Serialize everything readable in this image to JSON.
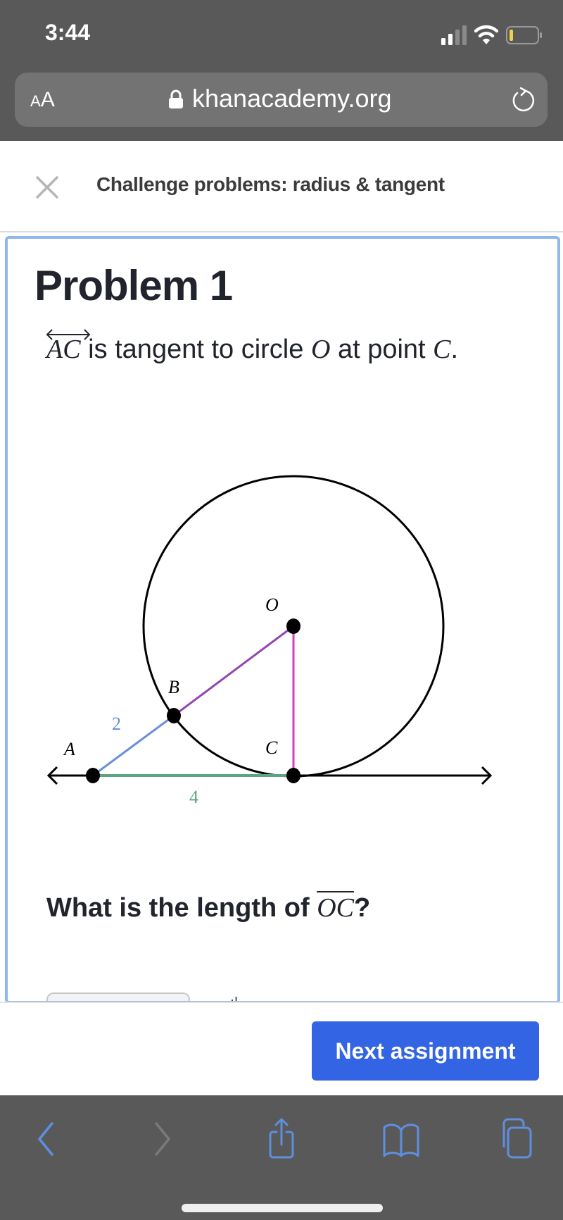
{
  "status_bar": {
    "time": "3:44",
    "signal_icon": "cellular-signal-icon",
    "wifi_icon": "wifi-icon",
    "battery_icon": "battery-low-icon",
    "battery_color": "#f0d24a"
  },
  "browser": {
    "text_size_label_small": "A",
    "text_size_label_large": "A",
    "lock_icon": "lock-icon",
    "url": "khanacademy.org",
    "reload_icon": "reload-icon"
  },
  "header": {
    "close_icon": "close-icon",
    "title": "Challenge problems: radius & tangent"
  },
  "problem": {
    "title": "Problem 1",
    "statement": {
      "ray_label": "AC",
      "text_1": " is tangent to circle ",
      "circle_label": "O",
      "text_2": " at point ",
      "point_label": "C",
      "text_3": "."
    },
    "diagram": {
      "points": {
        "O": "O",
        "A": "A",
        "B": "B",
        "C": "C"
      },
      "segment_labels": {
        "AB": "2",
        "AC": "4"
      },
      "colors": {
        "AB": "#6b8fd8",
        "AC": "#5aa680",
        "BO": "#9345b0",
        "OC": "#d63fbd",
        "circle": "#000000"
      }
    },
    "question": {
      "text": "What is the length of ",
      "segment": "OC",
      "suffix": "?"
    },
    "answer_cutoff_text": "·ı"
  },
  "footer": {
    "next_button": "Next assignment",
    "accent": "#3264e4"
  },
  "toolbar": {
    "back_icon": "back-chevron-icon",
    "forward_icon": "forward-chevron-icon",
    "share_icon": "share-icon",
    "bookmarks_icon": "bookmarks-book-icon",
    "tabs_icon": "tabs-icon",
    "icon_color": "#5e8fe0"
  }
}
